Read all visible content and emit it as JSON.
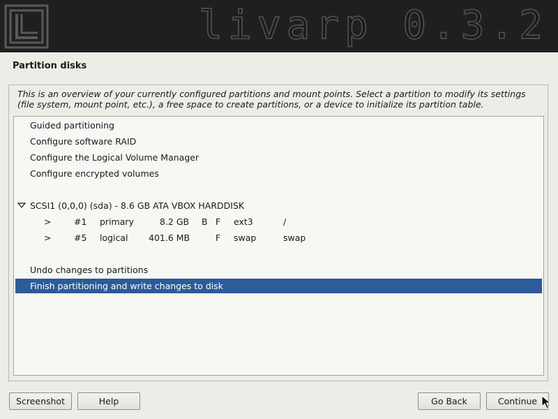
{
  "header": {
    "brand": "livarp 0.3.2",
    "logo_icon": "livarp-logo-icon"
  },
  "page": {
    "title": "Partition disks",
    "description_line1": "This is an overview of your currently configured partitions and mount points. Select a partition to modify its settings",
    "description_line2": "(file system, mount point, etc.), a free space to create partitions, or a device to initialize its partition table."
  },
  "list": {
    "actions": [
      "Guided partitioning",
      "Configure software RAID",
      "Configure the Logical Volume Manager",
      "Configure encrypted volumes"
    ],
    "disk": {
      "label": "SCSI1 (0,0,0) (sda) - 8.6 GB ATA VBOX HARDDISK",
      "expander_icon": "triangle-down-icon"
    },
    "partitions": [
      {
        "arrow": ">",
        "number": "#1",
        "type": "primary",
        "size": "8.2 GB",
        "bootable": "B",
        "format": "F",
        "fs": "ext3",
        "mount": "/"
      },
      {
        "arrow": ">",
        "number": "#5",
        "type": "logical",
        "size": "401.6 MB",
        "bootable": "",
        "format": "F",
        "fs": "swap",
        "mount": "swap"
      }
    ],
    "undo": "Undo changes to partitions",
    "finish": "Finish partitioning and write changes to disk",
    "selected_item": "Finish partitioning and write changes to disk"
  },
  "buttons": {
    "screenshot": "Screenshot",
    "help": "Help",
    "go_back": "Go Back",
    "continue": "Continue"
  },
  "colors": {
    "background": "#edece6",
    "banner": "#1f1f1f",
    "selection": "#2d5b97",
    "list_background": "#f7f8f3"
  }
}
